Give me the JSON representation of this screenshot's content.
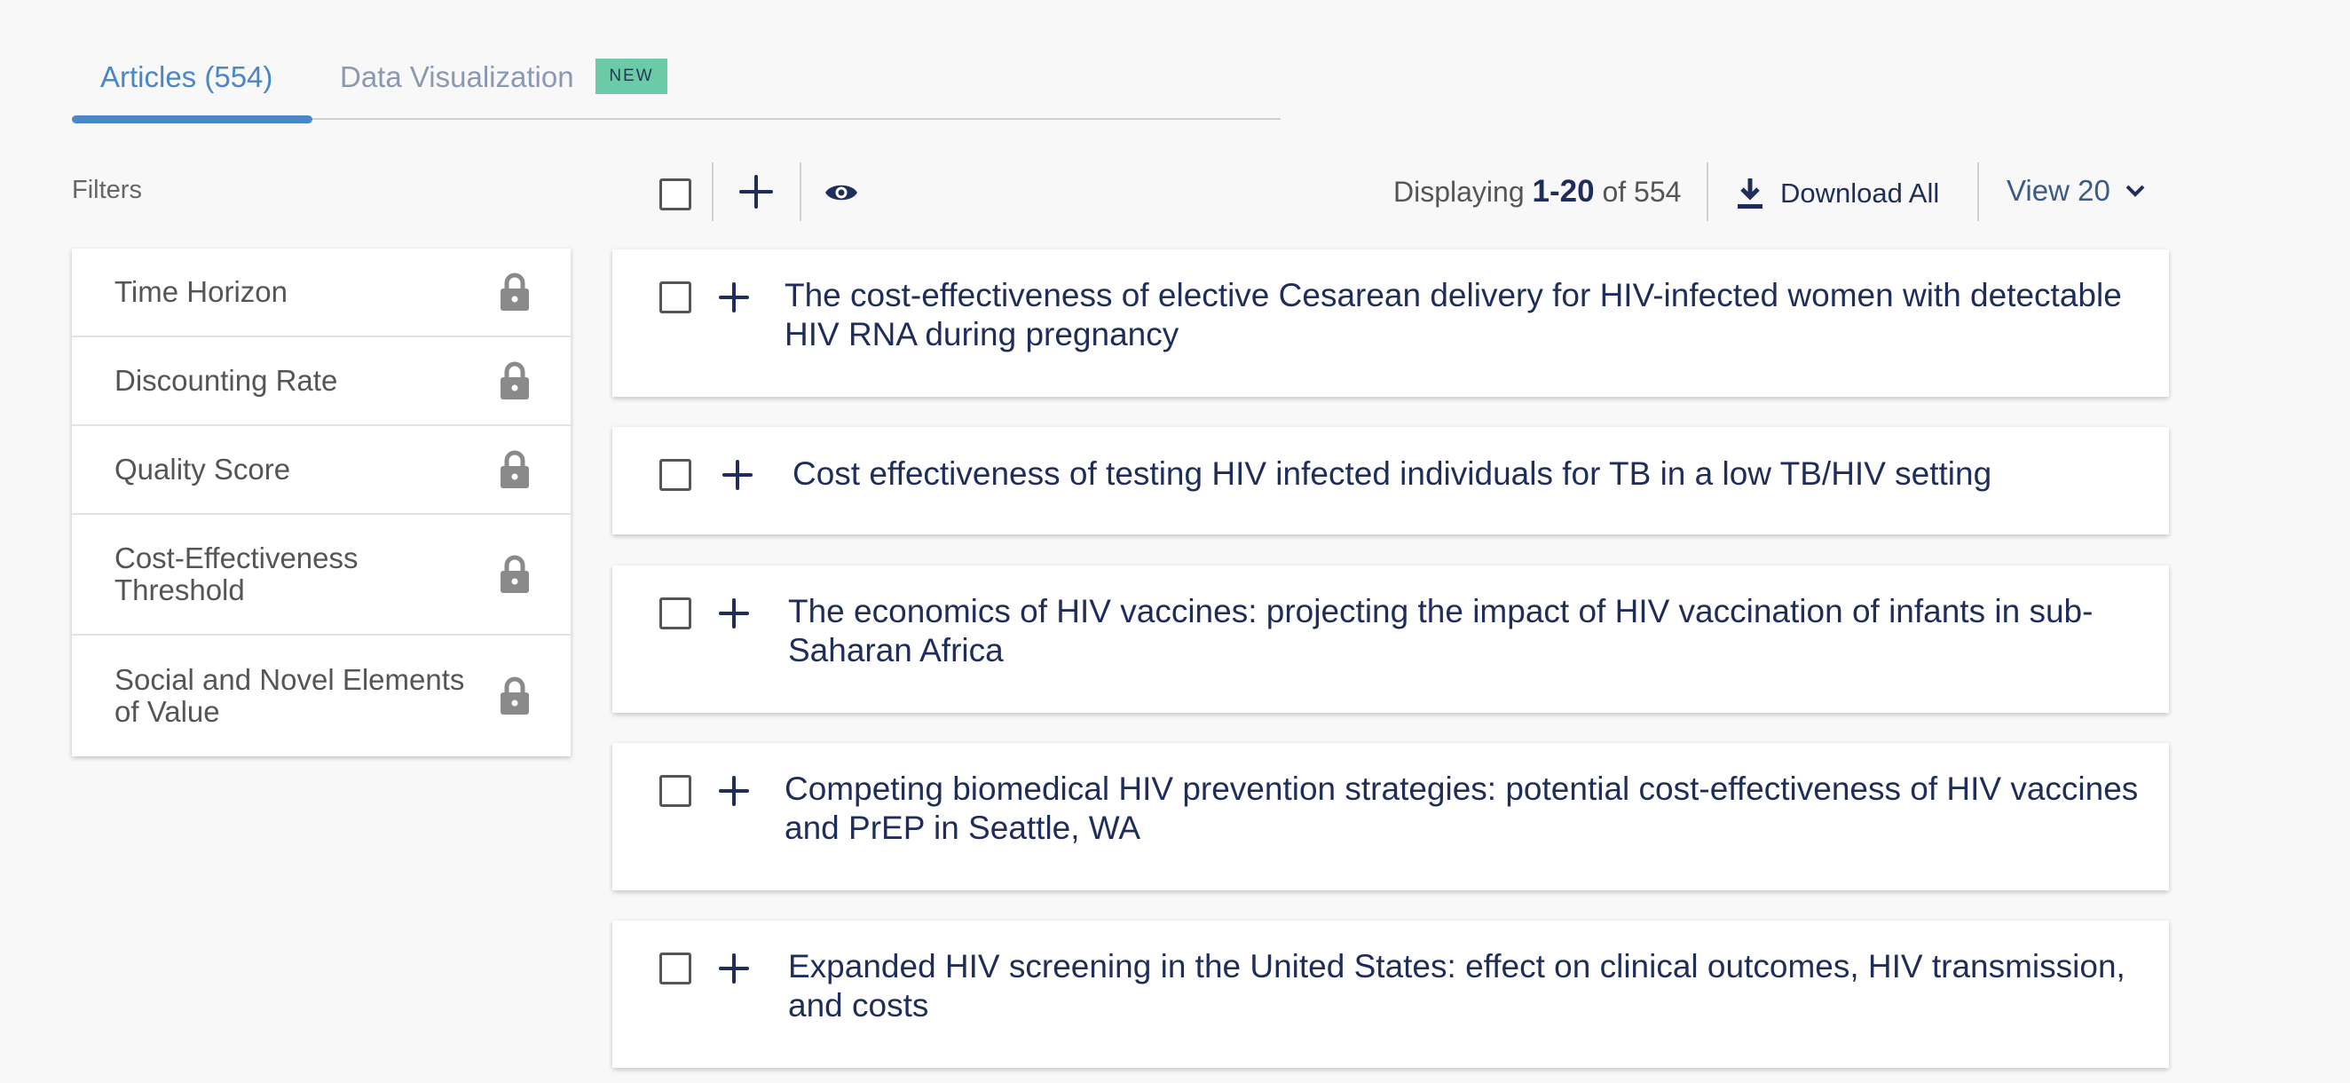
{
  "tabs": {
    "articles": "Articles (554)",
    "data_visualization": "Data Visualization",
    "new_badge": "NEW"
  },
  "filters": {
    "label": "Filters",
    "items": [
      {
        "label": "Time Horizon",
        "icon": "lock-icon"
      },
      {
        "label": "Discounting Rate",
        "icon": "lock-icon"
      },
      {
        "label": "Quality Score",
        "icon": "lock-icon"
      },
      {
        "label": "Cost-Effectiveness Threshold",
        "icon": "lock-icon"
      },
      {
        "label": "Social and Novel Elements of Value",
        "icon": "lock-icon"
      }
    ]
  },
  "toolbar": {
    "displaying_prefix": "Displaying",
    "range": "1-20",
    "of_text": "of 554",
    "download_label": "Download All",
    "view_label": "View 20"
  },
  "articles": [
    {
      "title": "The cost-effectiveness of elective Cesarean delivery for HIV-infected women with detectable HIV RNA during pregnancy"
    },
    {
      "title": "Cost effectiveness of testing HIV infected individuals for TB in a low TB/HIV setting"
    },
    {
      "title": "The economics of HIV vaccines: projecting the impact of HIV vaccination of infants in sub-Saharan Africa"
    },
    {
      "title": "Competing biomedical HIV prevention strategies: potential cost-effectiveness of HIV vaccines and PrEP in Seattle, WA"
    },
    {
      "title": "Expanded HIV screening in the United States: effect on clinical outcomes, HIV transmission, and costs"
    }
  ],
  "colors": {
    "accent": "#4a86c8",
    "title_text": "#1f2d5a",
    "new_badge": "#6ccaa8"
  }
}
